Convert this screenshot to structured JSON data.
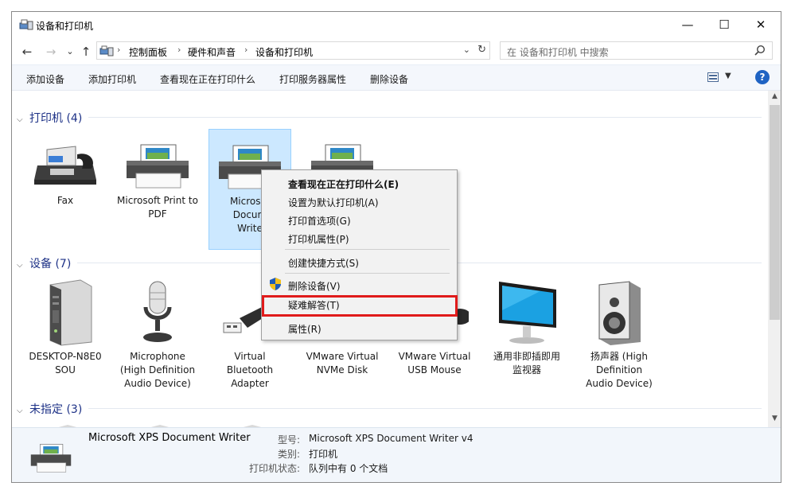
{
  "window": {
    "title": "设备和打印机",
    "minimize": "—",
    "maximize": "☐",
    "close": "✕"
  },
  "nav": {
    "back": "←",
    "forward": "→",
    "recent": "⌄",
    "up": "↑"
  },
  "breadcrumb": [
    "控制面板",
    "硬件和声音",
    "设备和打印机"
  ],
  "breadcrumb_sep": "›",
  "addr_drop": "⌄",
  "refresh": "↻",
  "search": {
    "placeholder": "在 设备和打印机 中搜索"
  },
  "toolbar": [
    "添加设备",
    "添加打印机",
    "查看现在正在打印什么",
    "打印服务器属性",
    "删除设备"
  ],
  "view_drop": "▼",
  "help": "?",
  "groups": {
    "printers": {
      "label": "打印机 (4)",
      "chev": "⌵"
    },
    "devices": {
      "label": "设备 (7)",
      "chev": "⌵"
    },
    "unspecified": {
      "label": "未指定 (3)",
      "chev": "⌵"
    }
  },
  "printers": [
    {
      "label": "Fax",
      "icon": "fax-icon"
    },
    {
      "label": "Microsoft Print to PDF",
      "icon": "printer-icon"
    },
    {
      "label": "Microsoft XPS Document Writer",
      "icon": "printer-icon",
      "visible": "Microsof\nDocum\nWrite"
    },
    {
      "label": "",
      "icon": "printer-icon"
    }
  ],
  "devices": [
    {
      "label": "DESKTOP-N8E0\nSOU",
      "icon": "computer-tower-icon"
    },
    {
      "label": "Microphone\n(High Definition\nAudio Device)",
      "icon": "microphone-icon"
    },
    {
      "label": "Virtual\nBluetooth\nAdapter",
      "icon": "usb-adapter-icon"
    },
    {
      "label": "VMware Virtual\nNVMe Disk",
      "icon": "disk-icon"
    },
    {
      "label": "VMware Virtual\nUSB Mouse",
      "icon": "mouse-icon"
    },
    {
      "label": "通用非即插即用\n监视器",
      "icon": "monitor-icon"
    },
    {
      "label": "扬声器 (High\nDefinition\nAudio Device)",
      "icon": "speaker-icon"
    }
  ],
  "context_menu": [
    {
      "label": "查看现在正在打印什么(E)",
      "bold": true
    },
    {
      "label": "设置为默认打印机(A)"
    },
    {
      "label": "打印首选项(G)"
    },
    {
      "label": "打印机属性(P)"
    },
    {
      "label": "创建快捷方式(S)"
    },
    {
      "label": "删除设备(V)"
    },
    {
      "label": "疑难解答(T)",
      "highlighted": true
    },
    {
      "label": "属性(R)"
    }
  ],
  "details": {
    "name": "Microsoft XPS Document Writer",
    "model_k": "型号:",
    "model_v": "Microsoft XPS Document Writer v4",
    "cat_k": "类别:",
    "cat_v": "打印机",
    "status_k": "打印机状态:",
    "status_v": "队列中有 0 个文档"
  },
  "colors": {
    "accent": "#1e3287",
    "highlight": "#e01b1b",
    "selection": "#cce8ff"
  }
}
